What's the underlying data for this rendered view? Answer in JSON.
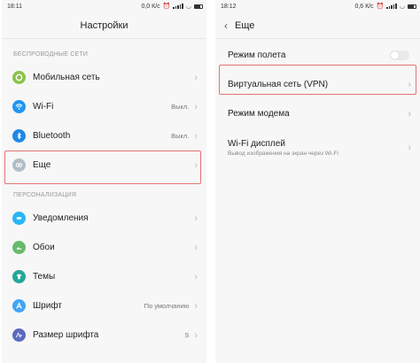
{
  "left": {
    "status": {
      "time": "18:11",
      "speed": "0,0 К/с"
    },
    "title": "Настройки",
    "sections": [
      {
        "label": "БЕСПРОВОДНЫЕ СЕТИ",
        "items": [
          {
            "label": "Мобильная сеть",
            "value": "",
            "icon": "mobile-network-icon",
            "color": "#8bc34a"
          },
          {
            "label": "Wi-Fi",
            "value": "Выкл.",
            "icon": "wifi-icon",
            "color": "#2196f3"
          },
          {
            "label": "Bluetooth",
            "value": "Выкл.",
            "icon": "bluetooth-icon",
            "color": "#1e88e5"
          },
          {
            "label": "Еще",
            "value": "",
            "icon": "more-icon",
            "color": "#b0bec5"
          }
        ]
      },
      {
        "label": "ПЕРСОНАЛИЗАЦИЯ",
        "items": [
          {
            "label": "Уведомления",
            "value": "",
            "icon": "notifications-icon",
            "color": "#29b6f6"
          },
          {
            "label": "Обои",
            "value": "",
            "icon": "wallpaper-icon",
            "color": "#66bb6a"
          },
          {
            "label": "Темы",
            "value": "",
            "icon": "themes-icon",
            "color": "#26a69a"
          },
          {
            "label": "Шрифт",
            "value": "По умолчанию",
            "icon": "font-icon",
            "color": "#42a5f5"
          },
          {
            "label": "Размер шрифта",
            "value": "S",
            "icon": "font-size-icon",
            "color": "#5c6bc0"
          }
        ]
      }
    ]
  },
  "right": {
    "status": {
      "time": "18:12",
      "speed": "0,6 К/с"
    },
    "title": "Еще",
    "items": [
      {
        "label": "Режим полета",
        "sub": ""
      },
      {
        "label": "Виртуальная сеть (VPN)",
        "sub": ""
      },
      {
        "label": "Режим модема",
        "sub": ""
      },
      {
        "label": "Wi-Fi дисплей",
        "sub": "Вывод изображения на экран через Wi-Fi"
      }
    ]
  },
  "highlight_color": "#e57373"
}
